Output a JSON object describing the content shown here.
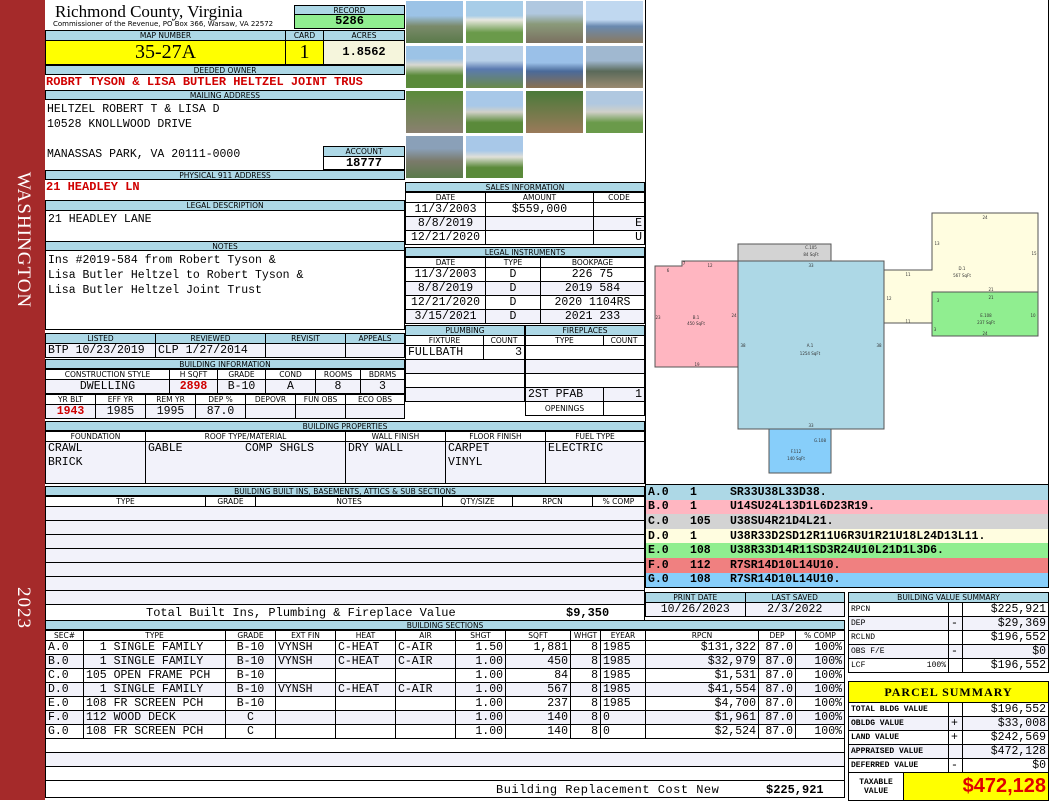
{
  "sidebar": {
    "district": "WASHINGTON",
    "year": "2023"
  },
  "header": {
    "county": "Richmond County, Virginia",
    "commissioner": "Commissioner of the Revenue, PO Box 366, Warsaw, VA 22572",
    "record_label": "RECORD",
    "record": "5286"
  },
  "parcel": {
    "map_label": "MAP NUMBER",
    "map": "35-27A",
    "card_label": "CARD",
    "card": "1",
    "acres_label": "ACRES",
    "acres": "1.8562"
  },
  "owner": {
    "label": "DEEDED OWNER",
    "value": "ROBRT TYSON & LISA BUTLER HELTZEL JOINT TRUS"
  },
  "mailing": {
    "label": "MAILING ADDRESS",
    "line1": "HELTZEL ROBERT T & LISA D",
    "line2": "10528 KNOLLWOOD DRIVE",
    "line3": "MANASSAS PARK, VA 20111-0000",
    "account_label": "ACCOUNT",
    "account": "18777"
  },
  "physical": {
    "label": "PHYSICAL 911 ADDRESS",
    "value": "21 HEADLEY LN"
  },
  "legal_desc": {
    "label": "LEGAL DESCRIPTION",
    "value": "21 HEADLEY LANE"
  },
  "notes": {
    "label": "NOTES",
    "line1": "Ins #2019-584 from Robert Tyson &",
    "line2": "Lisa Butler Heltzel to Robert Tyson &",
    "line3": "Lisa Butler Heltzel Joint Trust"
  },
  "review": {
    "headers": [
      "LISTED",
      "REVIEWED",
      "REVISIT",
      "APPEALS"
    ],
    "listed": "BTP 10/23/2019",
    "reviewed": "CLP  1/27/2014",
    "revisit": "",
    "appeals": ""
  },
  "building_info": {
    "label": "BUILDING INFORMATION",
    "headers1": [
      "CONSTRUCTION STYLE",
      "H SQFT",
      "GRADE",
      "COND",
      "ROOMS",
      "BDRMS"
    ],
    "values1": [
      "DWELLING",
      "2898",
      "B-10",
      "A",
      "8",
      "3"
    ],
    "headers2": [
      "YR BLT",
      "EFF YR",
      "REM YR",
      "DEP %",
      "DEPOVR",
      "FUN OBS",
      "ECO OBS"
    ],
    "values2": [
      "1943",
      "1985",
      "1995",
      "87.0",
      "",
      "",
      ""
    ]
  },
  "sales": {
    "label": "SALES INFORMATION",
    "headers": [
      "DATE",
      "AMOUNT",
      "CODE"
    ],
    "rows": [
      [
        "11/3/2003",
        "$559,000",
        ""
      ],
      [
        "8/8/2019",
        "",
        "E"
      ],
      [
        "12/21/2020",
        "",
        "U"
      ]
    ]
  },
  "legal_instruments": {
    "label": "LEGAL INSTRUMENTS",
    "headers": [
      "DATE",
      "TYPE",
      "BOOKPAGE"
    ],
    "rows": [
      [
        "11/3/2003",
        "D",
        "226 75"
      ],
      [
        "8/8/2019",
        "D",
        "2019 584"
      ],
      [
        "12/21/2020",
        "D",
        "2020 1104RS"
      ],
      [
        "3/15/2021",
        "D",
        "2021 233"
      ]
    ]
  },
  "plumbing": {
    "label": "PLUMBING",
    "headers": [
      "FIXTURE",
      "COUNT"
    ],
    "fixture": "FULLBATH",
    "count": "3"
  },
  "fireplaces": {
    "label": "FIREPLACES",
    "headers": [
      "TYPE",
      "COUNT"
    ],
    "type": "2ST PFAB",
    "count": "1",
    "openings_label": "OPENINGS",
    "openings": ""
  },
  "properties": {
    "label": "BUILDING PROPERTIES",
    "headers": [
      "FOUNDATION",
      "ROOF TYPE/MATERIAL",
      "WALL FINISH",
      "FLOOR FINISH",
      "FUEL TYPE"
    ],
    "foundation": [
      "CRAWL",
      "BRICK"
    ],
    "roof_type": "GABLE",
    "roof_material": "COMP SHGLS",
    "wall": "DRY WALL",
    "floor": [
      "CARPET",
      "VINYL"
    ],
    "fuel": "ELECTRIC"
  },
  "builtins": {
    "label": "BUILDING BUILT INS, BASEMENTS, ATTICS & SUB SECTIONS",
    "headers": [
      "TYPE",
      "GRADE",
      "NOTES",
      "QTY/SIZE",
      "RPCN",
      "% COMP"
    ],
    "total_label": "Total Built Ins, Plumbing & Fireplace Value",
    "total": "$9,350"
  },
  "sketch": {
    "labels": {
      "A": "A.1",
      "A_area": "1254 SqFt",
      "B": "B.1",
      "B_area": "450 SqFt",
      "C": "C.105",
      "C_area": "84 SqFt",
      "D": "D.1",
      "D_area": "567 SqFt",
      "E": "E.108",
      "E_area": "237 SqFt",
      "F": "F.112",
      "F_area": "140 SqFt",
      "G": "G.108"
    },
    "dims": [
      "6",
      "7",
      "12",
      "23",
      "24",
      "19",
      "33",
      "38",
      "38",
      "33",
      "24",
      "13",
      "15",
      "11",
      "12",
      "11",
      "21",
      "21",
      "10",
      "24",
      "3",
      "3"
    ],
    "legend": [
      [
        "A.0",
        "1",
        "SR33U38L33D38."
      ],
      [
        "B.0",
        "1",
        "U14SU24L13D1L6D23R19."
      ],
      [
        "C.0",
        "105",
        "U38SU4R21D4L21."
      ],
      [
        "D.0",
        "1",
        "U38R33D2SD12R11U6R3U1R21U18L24D13L11."
      ],
      [
        "E.0",
        "108",
        "U38R33D14R11SD3R24U10L21D1L3D6."
      ],
      [
        "F.0",
        "112",
        "R7SR14D10L14U10."
      ],
      [
        "G.0",
        "108",
        "R7SR14D10L14U10."
      ]
    ],
    "colors": {
      "A": "#add8e6",
      "B": "#ffb6c1",
      "C": "#d3d3d3",
      "D": "#fffde0",
      "E": "#90ee90",
      "F": "#f08080",
      "G": "#87cefa"
    }
  },
  "dates": {
    "print_label": "PRINT DATE",
    "print": "10/26/2023",
    "saved_label": "LAST SAVED",
    "saved": "2/3/2022"
  },
  "sections": {
    "label": "BUILDING SECTIONS",
    "headers": [
      "SEC#",
      "TYPE",
      "GRADE",
      "EXT FIN",
      "HEAT",
      "AIR",
      "SHGT",
      "SQFT",
      "WHGT",
      "EYEAR",
      "RPCN",
      "DEP",
      "% COMP"
    ],
    "rows": [
      [
        "A.0",
        "  1 SINGLE FAMILY",
        "B-10",
        "VYNSH",
        "C-HEAT",
        "C-AIR",
        "1.50",
        "1,881",
        "8",
        "1985",
        "$131,322",
        "87.0",
        "100%"
      ],
      [
        "B.0",
        "  1 SINGLE FAMILY",
        "B-10",
        "VYNSH",
        "C-HEAT",
        "C-AIR",
        "1.00",
        "450",
        "8",
        "1985",
        "$32,979",
        "87.0",
        "100%"
      ],
      [
        "C.0",
        "105 OPEN FRAME PCH",
        "B-10",
        "",
        "",
        "",
        "1.00",
        "84",
        "8",
        "1985",
        "$1,531",
        "87.0",
        "100%"
      ],
      [
        "D.0",
        "  1 SINGLE FAMILY",
        "B-10",
        "VYNSH",
        "C-HEAT",
        "C-AIR",
        "1.00",
        "567",
        "8",
        "1985",
        "$41,554",
        "87.0",
        "100%"
      ],
      [
        "E.0",
        "108 FR SCREEN PCH",
        "B-10",
        "",
        "",
        "",
        "1.00",
        "237",
        "8",
        "1985",
        "$4,700",
        "87.0",
        "100%"
      ],
      [
        "F.0",
        "112 WOOD DECK",
        "C",
        "",
        "",
        "",
        "1.00",
        "140",
        "8",
        "0",
        "$1,961",
        "87.0",
        "100%"
      ],
      [
        "G.0",
        "108 FR SCREEN PCH",
        "C",
        "",
        "",
        "",
        "1.00",
        "140",
        "8",
        "0",
        "$2,524",
        "87.0",
        "100%"
      ]
    ],
    "total_label": "Building Replacement Cost New",
    "total": "$225,921"
  },
  "value_summary": {
    "label": "BUILDING VALUE SUMMARY",
    "rows": [
      [
        "RPCN",
        "",
        "",
        "$225,921"
      ],
      [
        "DEP",
        "",
        "-",
        "$29,369"
      ],
      [
        "RCLND",
        "",
        "",
        "$196,552"
      ],
      [
        "OBS F/E",
        "",
        "-",
        "$0"
      ],
      [
        "LCF",
        "100%",
        "",
        "$196,552"
      ]
    ]
  },
  "parcel_summary": {
    "label": "PARCEL SUMMARY",
    "rows": [
      [
        "TOTAL BLDG VALUE",
        "",
        "$196,552"
      ],
      [
        "OBLDG VALUE",
        "+",
        "$33,008"
      ],
      [
        "LAND VALUE",
        "+",
        "$242,569"
      ],
      [
        "APPRAISED VALUE",
        "",
        "$472,128"
      ],
      [
        "DEFERRED VALUE",
        "-",
        "$0"
      ]
    ],
    "taxable_label": "TAXABLE VALUE",
    "taxable": "$472,128"
  }
}
